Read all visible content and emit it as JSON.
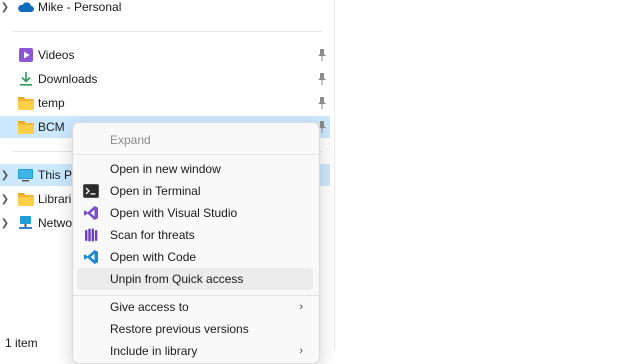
{
  "nav": {
    "onedrive": {
      "label": "Mike - Personal"
    },
    "quick_access": [
      {
        "label": "Videos",
        "icon": "videos-icon"
      },
      {
        "label": "Downloads",
        "icon": "downloads-icon"
      },
      {
        "label": "temp",
        "icon": "folder-icon"
      },
      {
        "label": "BCM",
        "icon": "folder-icon"
      }
    ],
    "this_pc": {
      "label": "This PC"
    },
    "libraries": {
      "label": "Libraries"
    },
    "network": {
      "label": "Network"
    }
  },
  "status": {
    "item_count": "1 item"
  },
  "context_menu": {
    "expand": "Expand",
    "open_new_window": "Open in new window",
    "open_terminal": "Open in Terminal",
    "open_visual_studio": "Open with Visual Studio",
    "scan_threats": "Scan for threats",
    "open_code": "Open with Code",
    "unpin_quick_access": "Unpin from Quick access",
    "give_access": "Give access to",
    "restore_versions": "Restore previous versions",
    "include_library": "Include in library"
  },
  "colors": {
    "selection": "#cce8ff",
    "menu_bg": "#f9f9f9",
    "folder": "#ffcf48"
  }
}
